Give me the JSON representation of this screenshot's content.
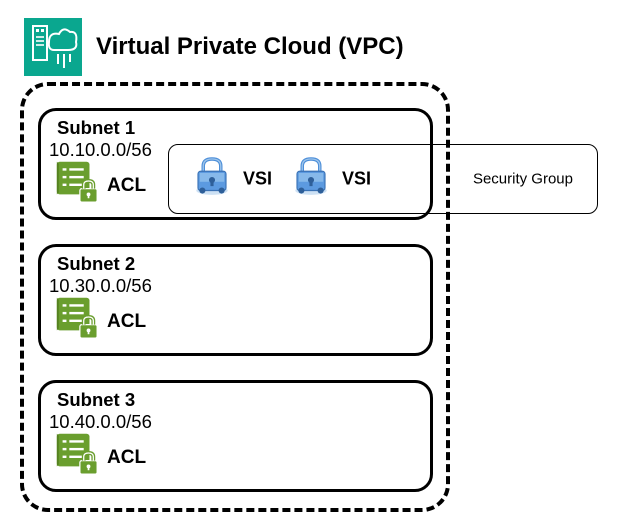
{
  "title": "Virtual Private Cloud (VPC)",
  "security_group_label": "Security Group",
  "vsi_label": "VSI",
  "acl_label": "ACL",
  "subnets": [
    {
      "name": "Subnet 1",
      "cidr": "10.10.0.0/56"
    },
    {
      "name": "Subnet 2",
      "cidr": "10.30.0.0/56"
    },
    {
      "name": "Subnet 3",
      "cidr": "10.40.0.0/56"
    }
  ],
  "colors": {
    "vpc_icon_bg": "#0aa78f",
    "acl_green": "#6a9e2e",
    "vsi_blue": "#4d8fd9"
  }
}
